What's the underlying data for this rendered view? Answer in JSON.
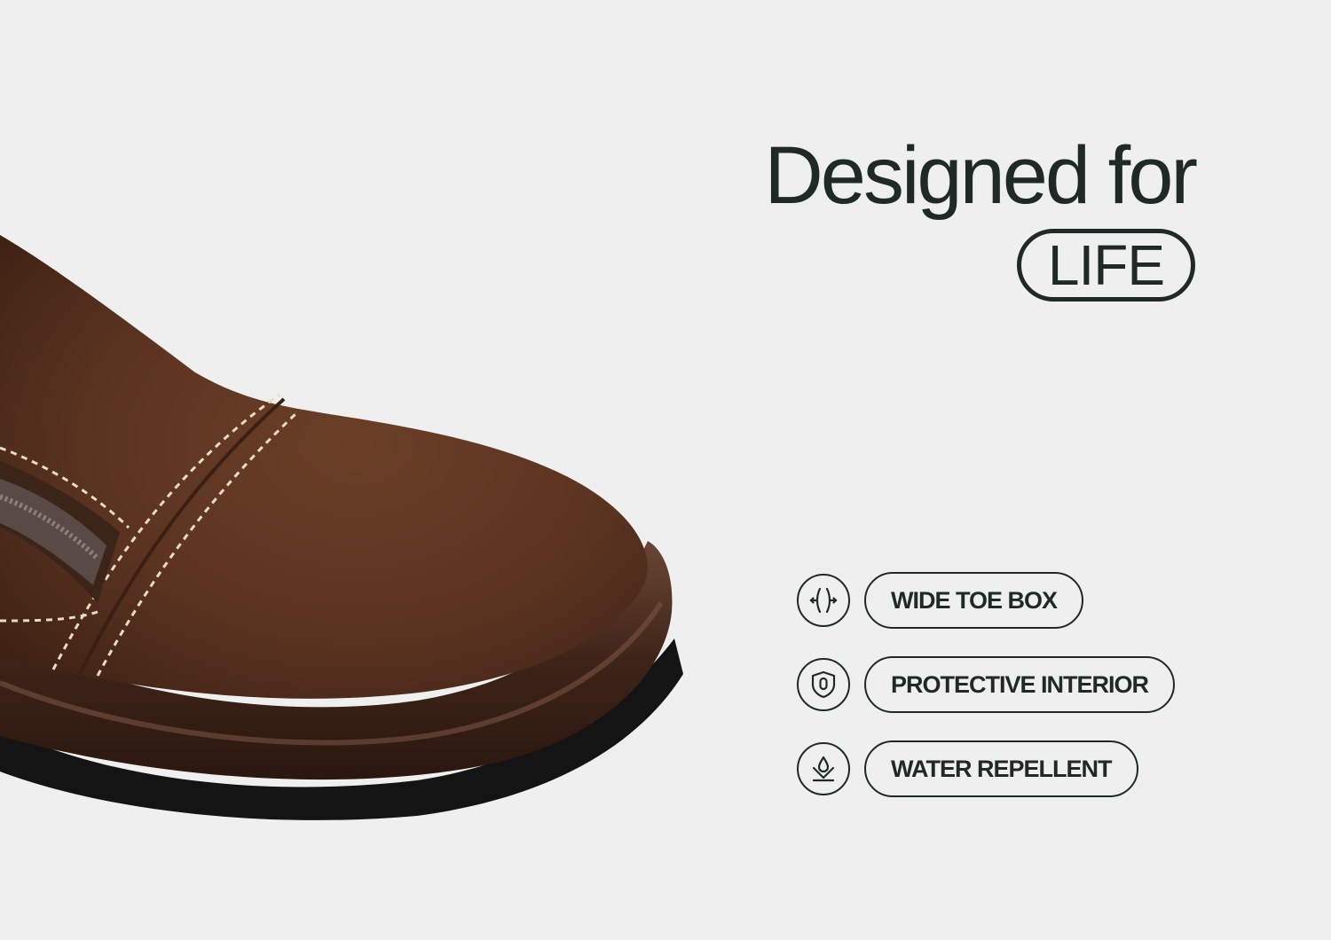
{
  "headline": {
    "line1": "Designed for",
    "pill": "LIFE"
  },
  "features": [
    {
      "icon": "wide-toe-box-icon",
      "label": "WIDE TOE BOX"
    },
    {
      "icon": "shield-icon",
      "label": "PROTECTIVE INTERIOR"
    },
    {
      "icon": "water-drop-icon",
      "label": "WATER REPELLENT"
    }
  ],
  "colors": {
    "background": "#efefef",
    "text": "#1f2a27",
    "leather": "#5a3420",
    "stitching": "#e8dcc3",
    "sole": "#111111"
  }
}
